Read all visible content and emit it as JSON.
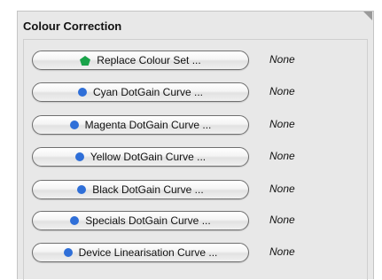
{
  "panel": {
    "title": "Colour Correction"
  },
  "rows": [
    {
      "label": "Replace Colour Set ...",
      "status": "None",
      "icon": "green-pentagon-icon",
      "icon_color": "#1aa34a"
    },
    {
      "label": "Cyan DotGain Curve ...",
      "status": "None",
      "icon": "blue-dot-icon",
      "icon_color": "#2f6fd8"
    },
    {
      "label": "Magenta DotGain Curve ...",
      "status": "None",
      "icon": "blue-dot-icon",
      "icon_color": "#2f6fd8"
    },
    {
      "label": "Yellow DotGain Curve ...",
      "status": "None",
      "icon": "blue-dot-icon",
      "icon_color": "#2f6fd8"
    },
    {
      "label": "Black DotGain Curve ...",
      "status": "None",
      "icon": "blue-dot-icon",
      "icon_color": "#2f6fd8"
    },
    {
      "label": "Specials DotGain Curve ...",
      "status": "None",
      "icon": "blue-dot-icon",
      "icon_color": "#2f6fd8"
    },
    {
      "label": "Device Linearisation Curve ...",
      "status": "None",
      "icon": "blue-dot-icon",
      "icon_color": "#2f6fd8"
    }
  ]
}
